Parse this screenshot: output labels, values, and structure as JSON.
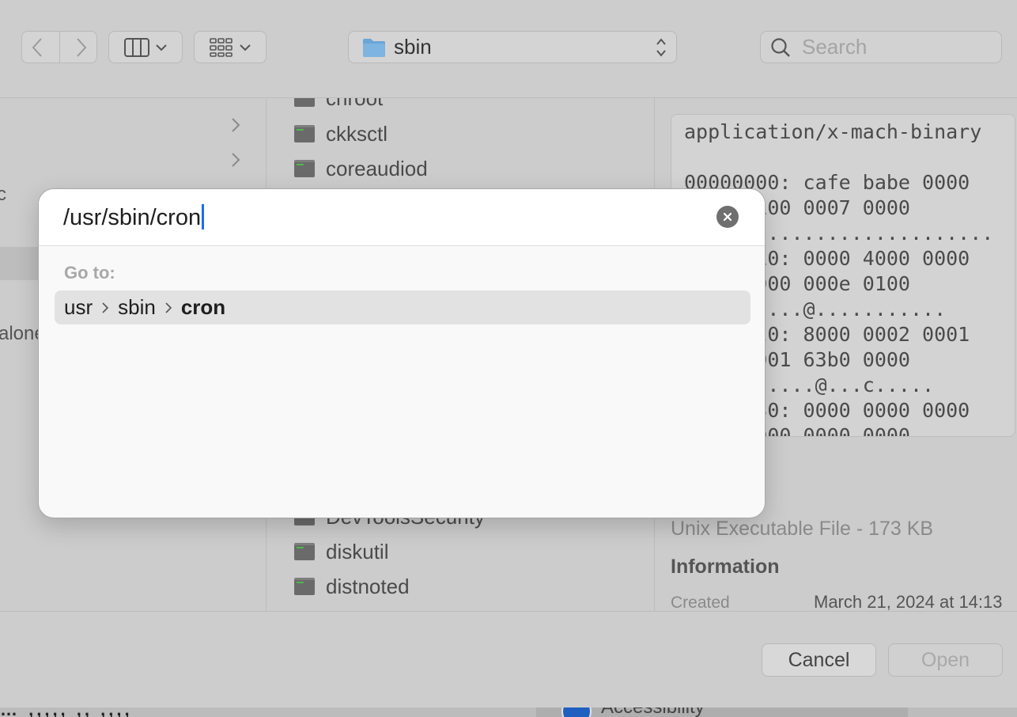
{
  "toolbar": {
    "path_popup": {
      "label": "sbin",
      "icon": "folder-icon"
    },
    "search": {
      "placeholder": "Search"
    }
  },
  "sidebar_column": {
    "partial_texts": [
      "c",
      "alone"
    ]
  },
  "file_list": {
    "items": [
      "chroot",
      "ckksctl",
      "coreaudiod",
      "DevToolsSecurity",
      "diskutil",
      "distnoted"
    ]
  },
  "preview": {
    "mime": "application/x-mach-binary",
    "hex_lines": [
      "",
      "00000000: cafe babe 0000",
      "0002 0100 0007 0000",
      "..........................",
      "00000010: 0000 4000 0000",
      "0000 0000 000e 0100",
      "..........@...........",
      "00000020: 8000 0002 0001",
      "0000 0001 63b0 0000",
      "...........@...c.....",
      "00000030: 0000 0000 0000",
      "0000 0000 0000 0000"
    ],
    "kind": "Unix Executable File - 173 KB",
    "info_heading": "Information",
    "created_label": "Created",
    "created_value": "March 21, 2024 at 14:13"
  },
  "buttons": {
    "cancel": "Cancel",
    "open": "Open"
  },
  "background": {
    "accessibility_text": "Accessibility",
    "left_text": "… ,,,,, ,, ,,,,"
  },
  "goto_dialog": {
    "path_value": "/usr/sbin/cron",
    "label": "Go to:",
    "suggestion": {
      "crumbs": [
        "usr",
        "sbin",
        "cron"
      ]
    }
  },
  "colors": {
    "caret": "#1b6ef3",
    "folder": "#6aa6d8"
  }
}
